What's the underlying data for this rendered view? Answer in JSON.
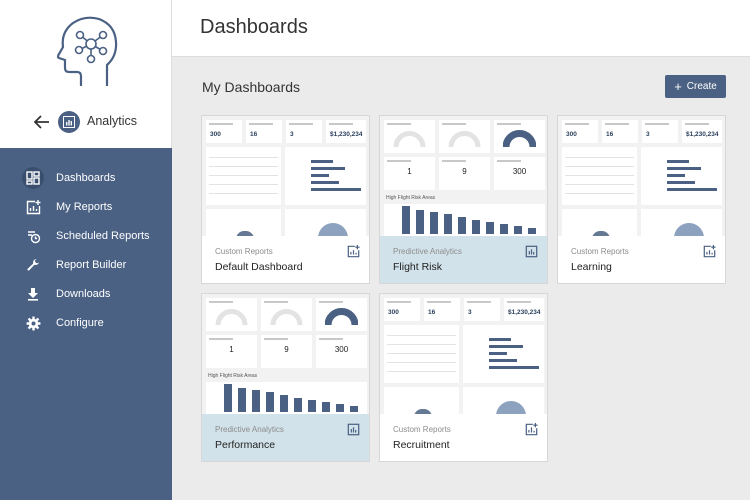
{
  "app": {
    "title": "Analytics"
  },
  "nav": {
    "items": [
      {
        "label": "Dashboards",
        "icon": "dashboard-grid-icon",
        "active": true
      },
      {
        "label": "My Reports",
        "icon": "report-add-icon"
      },
      {
        "label": "Scheduled Reports",
        "icon": "clock-report-icon"
      },
      {
        "label": "Report Builder",
        "icon": "wrench-icon"
      },
      {
        "label": "Downloads",
        "icon": "download-icon"
      },
      {
        "label": "Configure",
        "icon": "gear-icon"
      }
    ]
  },
  "header": {
    "title": "Dashboards"
  },
  "main": {
    "section_title": "My Dashboards",
    "create_label": "Create",
    "cards": [
      {
        "type": "Custom Reports",
        "title": "Default Dashboard",
        "preview": "custom",
        "icon": "report-add-icon"
      },
      {
        "type": "Predictive Analytics",
        "title": "Flight Risk",
        "preview": "predictive",
        "icon": "report-chart-icon",
        "highlight": true
      },
      {
        "type": "Custom Reports",
        "title": "Learning",
        "preview": "custom",
        "icon": "report-add-icon"
      },
      {
        "type": "Predictive Analytics",
        "title": "Performance",
        "preview": "predictive",
        "icon": "report-chart-icon",
        "highlight": true
      },
      {
        "type": "Custom Reports",
        "title": "Recruitment",
        "preview": "custom",
        "icon": "report-add-icon"
      }
    ]
  },
  "preview_custom": {
    "kpis": [
      "300",
      "16",
      "3",
      "$1,230,234"
    ],
    "kpi_labels": [
      "Total Employees",
      "New Starters",
      "New Departments",
      "Salary"
    ],
    "table_title": "Soft Skills (i) - Course Status Reports by Location",
    "bar_title": "Total Employees Per Department",
    "dist_title": "Employee Distribution by Age",
    "tenure_title": "Tenure Per Employment Type"
  },
  "preview_predictive": {
    "gauges": [
      "Current Flight Risk",
      "Overall Flight Risk",
      "Predictability Rating"
    ],
    "counts": [
      "1",
      "9",
      "300"
    ],
    "count_labels": [
      "Potential Regrettable Loss",
      "Regrettable Loss",
      "Turnover"
    ],
    "count_sub": [
      "Employees",
      "Employees",
      "Employees"
    ],
    "areas_title": "High Flight Risk Areas",
    "areas_chart_title": "High Flight Employees by Department"
  }
}
